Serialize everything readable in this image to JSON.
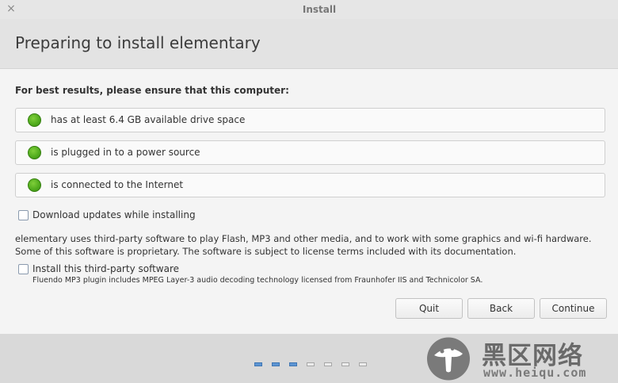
{
  "window": {
    "title": "Install",
    "close_glyph": "×"
  },
  "header": {
    "title": "Preparing to install elementary"
  },
  "requirements": {
    "intro": "For best results, please ensure that this computer:",
    "items": [
      {
        "label": "has at least 6.4 GB available drive space",
        "status": "ok",
        "icon": "green-dot-icon"
      },
      {
        "label": "is plugged in to a power source",
        "status": "ok",
        "icon": "green-dot-icon"
      },
      {
        "label": "is connected to the Internet",
        "status": "ok",
        "icon": "green-dot-icon"
      }
    ]
  },
  "options": {
    "download_updates": {
      "label": "Download updates while installing",
      "checked": false
    },
    "third_party_info": "elementary uses third-party software to play Flash, MP3 and other media, and to work with some graphics and wi-fi hardware. Some of this software is proprietary. The software is subject to license terms included with its documentation.",
    "third_party": {
      "label": "Install this third-party software",
      "checked": false
    },
    "fluendo_note": "Fluendo MP3 plugin includes MPEG Layer-3 audio decoding technology licensed from Fraunhofer IIS and Technicolor SA."
  },
  "buttons": {
    "quit": "Quit",
    "back": "Back",
    "continue": "Continue"
  },
  "progress": {
    "total_steps": 7,
    "completed_steps": 3,
    "completed_color": "#5d95d3"
  },
  "watermark": {
    "text": "黑区网络",
    "url": "www.heiqu.com"
  },
  "colors": {
    "ok": "#4faa1c",
    "accent": "#5d95d3"
  }
}
